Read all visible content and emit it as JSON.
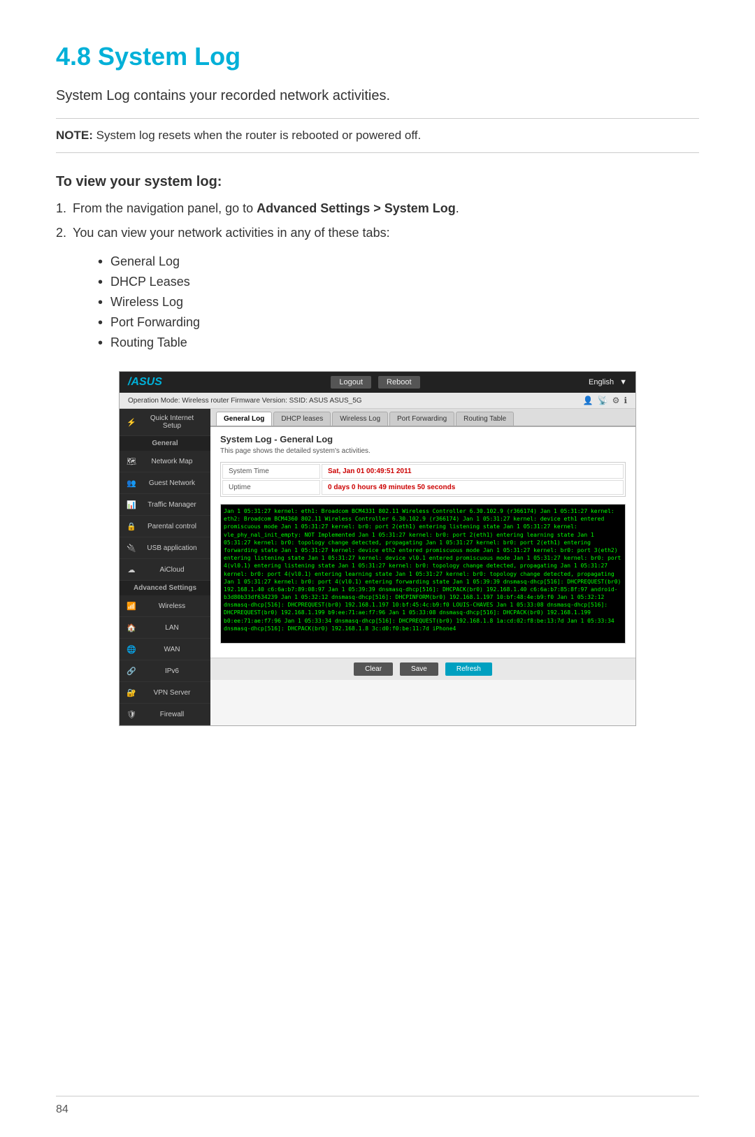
{
  "page": {
    "title": "4.8   System Log",
    "subtitle": "System Log contains your recorded network activities.",
    "note_label": "NOTE:",
    "note_text": "  System log resets when the router is rebooted or powered off.",
    "section_heading": "To view your system log:",
    "step1_prefix": "1.",
    "step1_text": "From the navigation panel, go to ",
    "step1_bold": "Advanced Settings > System Log",
    "step1_end": ".",
    "step2_prefix": "2.",
    "step2_text": "You can view your network activities in any of these tabs:",
    "bullets": [
      "General Log",
      "DHCP Leases",
      "Wireless Log",
      "Port Forwarding",
      "Routing Table"
    ],
    "page_number": "84"
  },
  "router_ui": {
    "logo": "/ASUS",
    "header_buttons": [
      "Logout",
      "Reboot"
    ],
    "header_right": "English",
    "status_bar": "Operation Mode: Wireless router    Firmware Version:    SSID: ASUS  ASUS_5G",
    "tabs": [
      "General Log",
      "DHCP leases",
      "Wireless Log",
      "Port Forwarding",
      "Routing Table"
    ],
    "active_tab": "General Log",
    "content_title": "System Log - General Log",
    "content_subtitle": "This page shows the detailed system's activities.",
    "info_rows": [
      {
        "label": "System Time",
        "value": "Sat, Jan 01  00:49:51  2011"
      },
      {
        "label": "Uptime",
        "value": "0 days 0 hours 49 minutes 50 seconds"
      }
    ],
    "log_lines": [
      "Jan  1 05:31:27 kernel: eth1: Broadcom BCM4331 802.11 Wireless Controller 6.30.102.9 (r366174)",
      "Jan  1 05:31:27 kernel: eth2: Broadcom BCM4360 802.11 Wireless Controller 6.30.102.9 (r366174)",
      "Jan  1 05:31:27 kernel: device eth1 entered promiscuous mode",
      "Jan  1 05:31:27 kernel: br0: port 2(eth1) entering listening state",
      "Jan  1 05:31:27 kernel: vle_phy_nal_init_empty: NOT Implemented",
      "Jan  1 05:31:27 kernel: br0: port 2(eth1) entering learning state",
      "Jan  1 05:31:27 kernel: br0: topology change detected, propagating",
      "Jan  1 05:31:27 kernel: br0: port 2(eth1) entering forwarding state",
      "Jan  1 05:31:27 kernel: device eth2 entered promiscuous mode",
      "Jan  1 05:31:27 kernel: br0: port 3(eth2) entering listening state",
      "Jan  1 05:31:27 kernel: device vl0.1 entered promiscuous mode",
      "Jan  1 05:31:27 kernel: br0: port 4(vl0.1) entering listening state",
      "Jan  1 05:31:27 kernel: br0: topology change detected, propagating",
      "Jan  1 05:31:27 kernel: br0: port 4(vl0.1) entering learning state",
      "Jan  1 05:31:27 kernel: br0: topology change detected, propagating",
      "Jan  1 05:31:27 kernel: br0: port 4(vl0.1) entering forwarding state",
      "Jan  1 05:39:39 dnsmasq-dhcp[516]: DHCPREQUEST(br0) 192.168.1.40 c6:6a:b7:89:08:97",
      "Jan  1 05:39:39 dnsmasq-dhcp[516]: DHCPACK(br0) 192.168.1.40 c6:6a:b7:85:8f:97 android-b3d80b33df634239",
      "Jan  1 05:32:12 dnsmasq-dhcp[516]: DHCPINFORM(br0) 192.168.1.197 10:bf:48:4e:b9:f0",
      "Jan  1 05:32:12 dnsmasq-dhcp[516]: DHCPREQUEST(br0) 192.168.1.197 10:bf:45:4c:b9:f0 LOUIS-CHAVES",
      "Jan  1 05:33:08 dnsmasq-dhcp[516]: DHCPREQUEST(br0) 192.168.1.199 b9:ee:71:ae:f7:96",
      "Jan  1 05:33:08 dnsmasq-dhcp[516]: DHCPACK(br0) 192.168.1.199 b0:ee:71:ae:f7:96",
      "Jan  1 05:33:34 dnsmasq-dhcp[516]: DHCPREQUEST(br0) 192.168.1.8 1a:cd:02:f8:be:13:7d",
      "Jan  1 05:33:34 dnsmasq-dhcp[516]: DHCPACK(br0) 192.168.1.8 3c:d0:f0:be:11:7d iPhone4"
    ],
    "buttons": [
      "Clear",
      "Save",
      "Refresh"
    ],
    "sidebar_sections": [
      {
        "label": null,
        "items": [
          {
            "icon": "⚡",
            "label": "Quick Internet\nSetup",
            "active": false
          }
        ]
      },
      {
        "label": "General",
        "items": [
          {
            "icon": "🗺",
            "label": "Network Map",
            "active": false
          },
          {
            "icon": "👥",
            "label": "Guest Network",
            "active": false
          },
          {
            "icon": "📊",
            "label": "Traffic Manager",
            "active": false
          }
        ]
      },
      {
        "label": null,
        "items": [
          {
            "icon": "🔒",
            "label": "Parental control",
            "active": false
          },
          {
            "icon": "🔌",
            "label": "USB application",
            "active": false
          },
          {
            "icon": "☁",
            "label": "AiCloud",
            "active": false
          }
        ]
      },
      {
        "label": "Advanced Settings",
        "items": [
          {
            "icon": "📶",
            "label": "Wireless",
            "active": false
          },
          {
            "icon": "🏠",
            "label": "LAN",
            "active": false
          },
          {
            "icon": "🌐",
            "label": "WAN",
            "active": false
          },
          {
            "icon": "🔗",
            "label": "IPv6",
            "active": false
          },
          {
            "icon": "🔐",
            "label": "VPN Server",
            "active": false
          },
          {
            "icon": "🛡",
            "label": "Firewall",
            "active": false
          }
        ]
      }
    ]
  }
}
